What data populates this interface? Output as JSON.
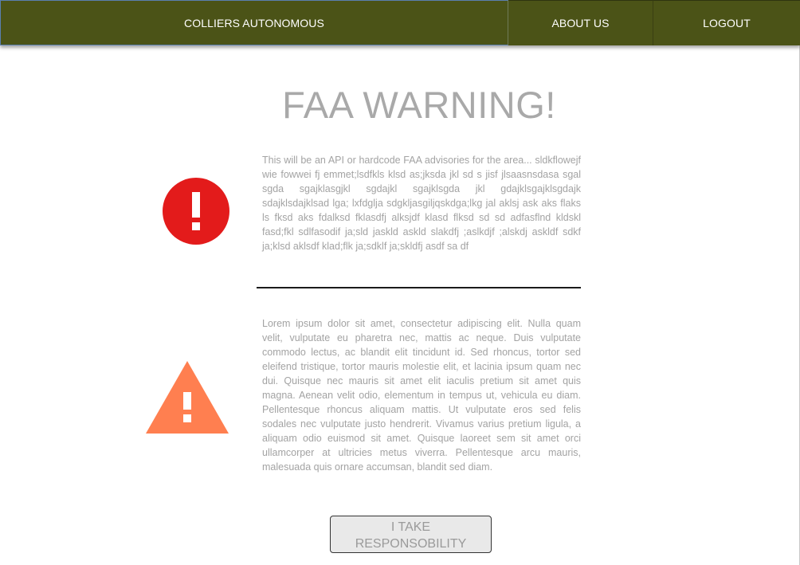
{
  "nav": {
    "brand": "COLLIERS AUTONOMOUS",
    "about": "ABOUT US",
    "logout": "LOGOUT",
    "color": "#4b5317"
  },
  "main": {
    "title": "FAA WARNING!",
    "block1": {
      "icon": "error-icon",
      "icon_color": "#e31b1b",
      "text": "This will be an API or hardcode FAA advisories for the area... sldkflowejf wie fowwei fj emmet;lsdfkls klsd as;jksda jkl sd s jisf jlsaasnsdasa sgal sgda sgajklasgjkl sgdajkl sgajklsgda jkl gdajklsgajklsgdajk sdajklsdajklsad lga; lxfdglja sdgkljasgiljqskdga;lkg jal aklsj ask aks flaks ls fksd aks fdalksd fklasdfj alksjdf klasd flksd sd sd adfasflnd kldskl fasd;fkl sdlfasodif ja;sld jaskld askld slakdfj ;aslkdjf ;alskdj askldf sdkf ja;klsd aklsdf klad;flk ja;sdklf ja;skldfj asdf sa df"
    },
    "block2": {
      "icon": "warning-icon",
      "icon_color": "#ff7f50",
      "text": "Lorem ipsum dolor sit amet, consectetur adipiscing elit. Nulla quam velit, vulputate eu pharetra nec, mattis ac neque. Duis vulputate commodo lectus, ac blandit elit tincidunt id. Sed rhoncus, tortor sed eleifend tristique, tortor mauris molestie elit, et lacinia ipsum quam nec dui. Quisque nec mauris sit amet elit iaculis pretium sit amet quis magna. Aenean velit odio, elementum in tempus ut, vehicula eu diam. Pellentesque rhoncus aliquam mattis. Ut vulputate eros sed felis sodales nec vulputate justo hendrerit. Vivamus varius pretium ligula, a aliquam odio euismod sit amet. Quisque laoreet sem sit amet orci ullamcorper at ultricies metus viverra. Pellentesque arcu mauris, malesuada quis ornare accumsan, blandit sed diam."
    },
    "button_label": "I TAKE RESPONSOBILITY"
  }
}
